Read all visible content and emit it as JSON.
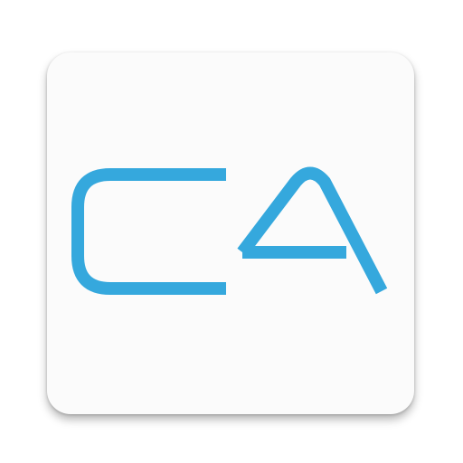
{
  "app_icon": {
    "logo_text": "CA",
    "brand_color": "#35a8dd",
    "background_color": "#fbfbfb",
    "icon_name": "ca-logo-icon"
  }
}
